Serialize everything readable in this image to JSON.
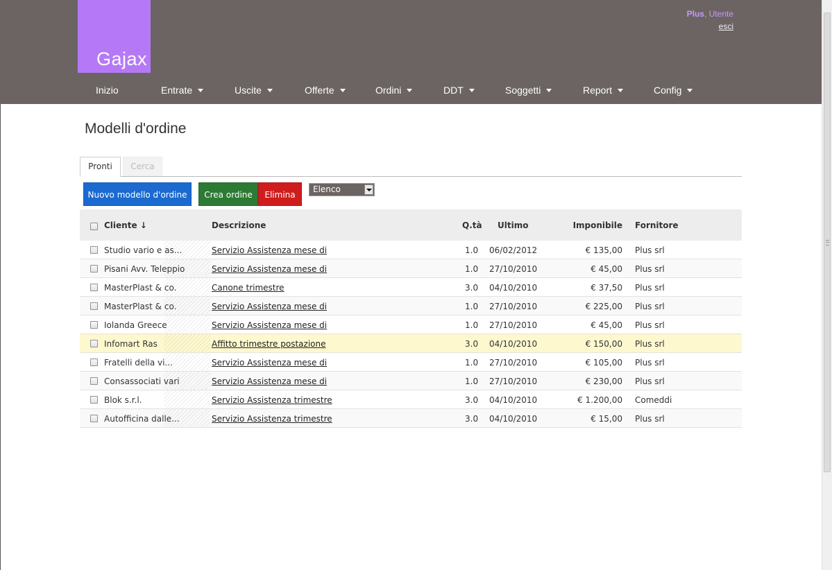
{
  "brand": {
    "logo_text": "Gajax",
    "logo_color": "#b579f7",
    "header_color": "#6b6463"
  },
  "user": {
    "company": "Plus",
    "separator": ",",
    "name": "Utente",
    "logout": "esci"
  },
  "nav": [
    {
      "label": "Inizio",
      "dropdown": false
    },
    {
      "label": "Entrate",
      "dropdown": true
    },
    {
      "label": "Uscite",
      "dropdown": true
    },
    {
      "label": "Offerte",
      "dropdown": true
    },
    {
      "label": "Ordini",
      "dropdown": true
    },
    {
      "label": "DDT",
      "dropdown": true
    },
    {
      "label": "Soggetti",
      "dropdown": true
    },
    {
      "label": "Report",
      "dropdown": true
    },
    {
      "label": "Config",
      "dropdown": true
    }
  ],
  "page_title": "Modelli d'ordine",
  "tabs": [
    {
      "label": "Pronti",
      "active": true
    },
    {
      "label": "Cerca",
      "active": false
    }
  ],
  "actions": {
    "new_label": "Nuovo modello d'ordine",
    "create_label": "Crea ordine",
    "delete_label": "Elimina",
    "view_select": "Elenco"
  },
  "table": {
    "headers": {
      "cliente": "Cliente ↓",
      "descrizione": "Descrizione",
      "qta": "Q.tà",
      "ultimo": "Ultimo",
      "imponibile": "Imponibile",
      "fornitore": "Fornitore"
    },
    "rows": [
      {
        "cliente": "Studio vario e as...",
        "descrizione": "Servizio Assistenza mese di",
        "qta": "1.0",
        "ultimo": "06/02/2012",
        "imponibile": "€ 135,00",
        "fornitore": "Plus srl",
        "highlight": false
      },
      {
        "cliente": "Pisani Avv. Teleppio",
        "descrizione": "Servizio Assistenza mese di",
        "qta": "1.0",
        "ultimo": "27/10/2010",
        "imponibile": "€ 45,00",
        "fornitore": "Plus srl",
        "highlight": false
      },
      {
        "cliente": "MasterPlast & co.",
        "descrizione": "Canone trimestre",
        "qta": "3.0",
        "ultimo": "04/10/2010",
        "imponibile": "€ 37,50",
        "fornitore": "Plus srl",
        "highlight": false
      },
      {
        "cliente": "MasterPlast & co.",
        "descrizione": "Servizio Assistenza mese di",
        "qta": "1.0",
        "ultimo": "27/10/2010",
        "imponibile": "€ 225,00",
        "fornitore": "Plus srl",
        "highlight": false
      },
      {
        "cliente": "Iolanda Greece",
        "descrizione": "Servizio Assistenza mese di",
        "qta": "1.0",
        "ultimo": "27/10/2010",
        "imponibile": "€ 45,00",
        "fornitore": "Plus srl",
        "highlight": false
      },
      {
        "cliente": "Infomart Ras",
        "descrizione": "Affitto trimestre postazione",
        "qta": "3.0",
        "ultimo": "04/10/2010",
        "imponibile": "€ 150,00",
        "fornitore": "Plus srl",
        "highlight": true
      },
      {
        "cliente": "Fratelli della vi...",
        "descrizione": "Servizio Assistenza mese di",
        "qta": "1.0",
        "ultimo": "27/10/2010",
        "imponibile": "€ 105,00",
        "fornitore": "Plus srl",
        "highlight": false
      },
      {
        "cliente": "Consassociati vari",
        "descrizione": "Servizio Assistenza mese di",
        "qta": "1.0",
        "ultimo": "27/10/2010",
        "imponibile": "€ 230,00",
        "fornitore": "Plus srl",
        "highlight": false
      },
      {
        "cliente": "Blok s.r.l.",
        "descrizione": "Servizio Assistenza trimestre",
        "qta": "3.0",
        "ultimo": "04/10/2010",
        "imponibile": "€ 1.200,00",
        "fornitore": "Comeddi",
        "highlight": false
      },
      {
        "cliente": "Autofficina dalle...",
        "descrizione": "Servizio Assistenza trimestre",
        "qta": "3.0",
        "ultimo": "04/10/2010",
        "imponibile": "€ 15,00",
        "fornitore": "Plus srl",
        "highlight": false
      }
    ]
  }
}
